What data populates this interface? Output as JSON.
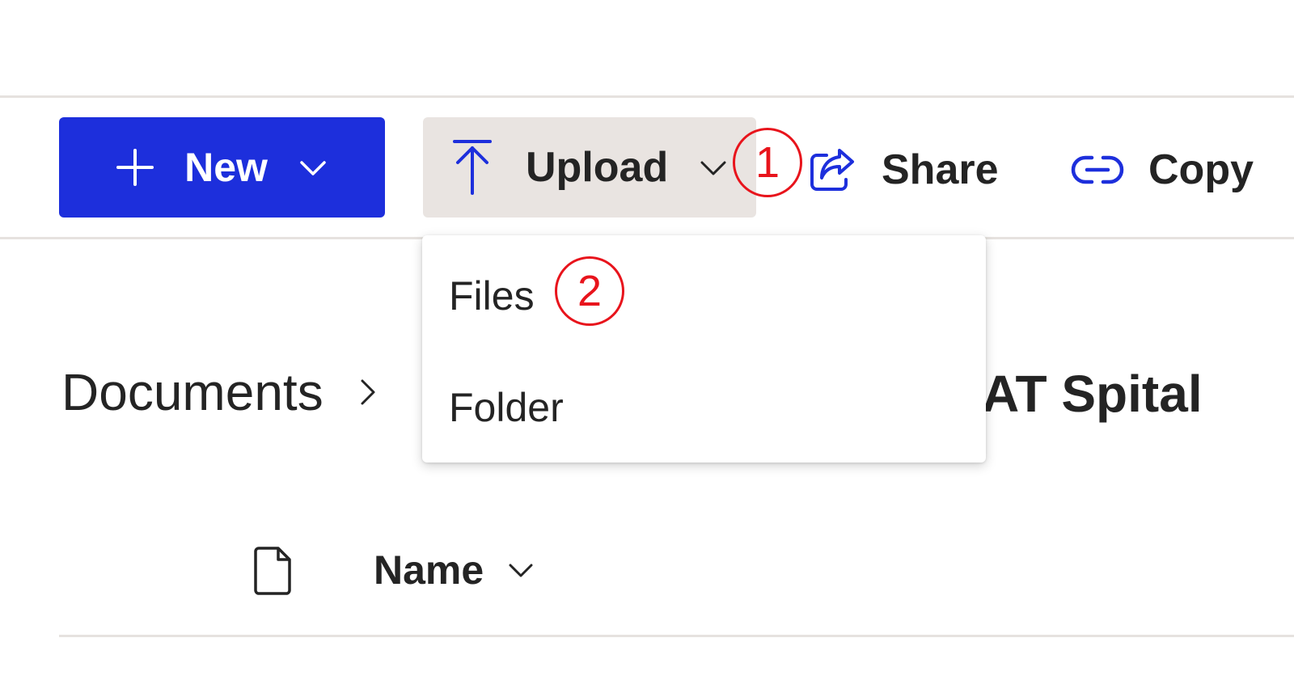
{
  "toolbar": {
    "new_label": "New",
    "upload_label": "Upload",
    "share_label": "Share",
    "copy_label": "Copy",
    "new_button_color": "#1d2fdc",
    "upload_button_bg": "#e9e4e1",
    "icon_accent_color": "#1d2fdc"
  },
  "upload_menu": {
    "items": [
      {
        "label": "Files"
      },
      {
        "label": "Folder"
      }
    ]
  },
  "annotations": {
    "marker_1": "1",
    "marker_2": "2",
    "marker_color": "#e8141c"
  },
  "breadcrumb": {
    "root": "Documents",
    "current": "AT Spital"
  },
  "list_header": {
    "name_column": "Name"
  },
  "icons": {
    "new": "plus-icon",
    "new_dropdown": "chevron-down-icon",
    "upload": "upload-arrow-icon",
    "upload_dropdown": "chevron-down-icon",
    "share": "share-icon",
    "copy": "link-icon",
    "breadcrumb_separator": "chevron-right-icon",
    "file_type": "file-icon",
    "sort": "chevron-down-icon"
  }
}
